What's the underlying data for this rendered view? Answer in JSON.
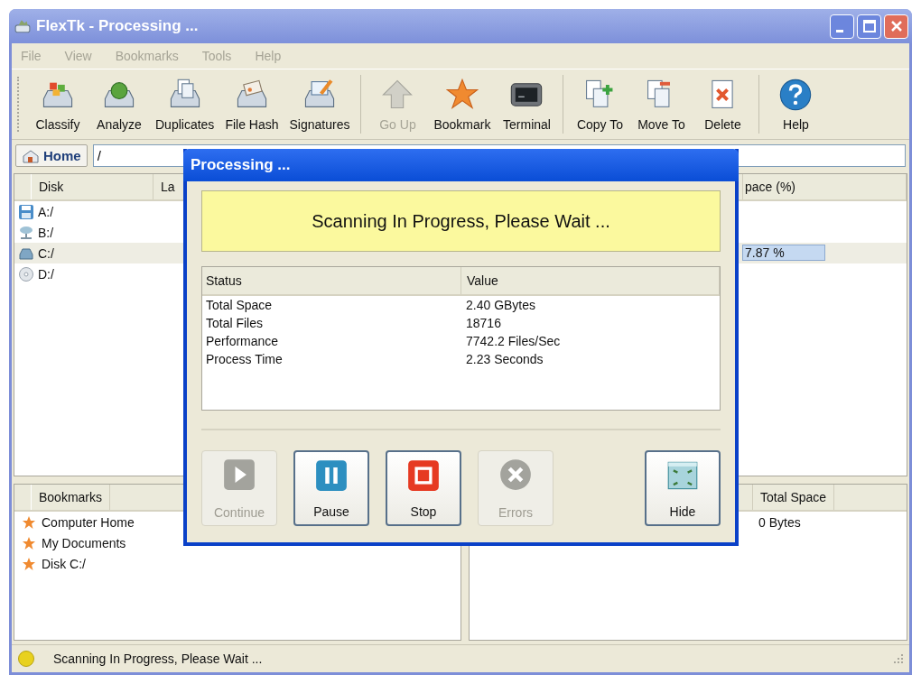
{
  "window": {
    "title": "FlexTk - Processing ..."
  },
  "menu": [
    {
      "label": "File",
      "disabled": true
    },
    {
      "label": "View",
      "disabled": true
    },
    {
      "label": "Bookmarks",
      "disabled": true
    },
    {
      "label": "Tools",
      "disabled": true
    },
    {
      "label": "Help",
      "disabled": true
    }
  ],
  "toolbar": [
    {
      "label": "Classify",
      "kind": "classify",
      "disabled": false,
      "separator_before": false
    },
    {
      "label": "Analyze",
      "kind": "analyze",
      "disabled": false,
      "separator_before": false
    },
    {
      "label": "Duplicates",
      "kind": "duplicates",
      "disabled": false,
      "separator_before": false
    },
    {
      "label": "File Hash",
      "kind": "hash",
      "disabled": false,
      "separator_before": false
    },
    {
      "label": "Signatures",
      "kind": "signatures",
      "disabled": false,
      "separator_before": false
    },
    {
      "label": "Go Up",
      "kind": "up",
      "disabled": true,
      "separator_before": true
    },
    {
      "label": "Bookmark",
      "kind": "star",
      "disabled": false,
      "separator_before": false
    },
    {
      "label": "Terminal",
      "kind": "terminal",
      "disabled": false,
      "separator_before": false
    },
    {
      "label": "Copy To",
      "kind": "copy",
      "disabled": false,
      "separator_before": true
    },
    {
      "label": "Move To",
      "kind": "move",
      "disabled": false,
      "separator_before": false
    },
    {
      "label": "Delete",
      "kind": "delete",
      "disabled": false,
      "separator_before": false
    },
    {
      "label": "Help",
      "kind": "help",
      "disabled": false,
      "separator_before": true
    }
  ],
  "address": {
    "home": "Home",
    "path": "/"
  },
  "disks": {
    "columns": [
      "Disk",
      "La",
      "pace (%)"
    ],
    "rows": [
      {
        "name": "A:/",
        "kind": "floppy",
        "selected": false
      },
      {
        "name": "B:/",
        "kind": "network",
        "selected": false
      },
      {
        "name": "C:/",
        "kind": "drive",
        "selected": true,
        "space": "7.87 %"
      },
      {
        "name": "D:/",
        "kind": "cdrom",
        "selected": false
      }
    ]
  },
  "bookmarks": {
    "column": "Bookmarks",
    "items": [
      "Computer Home",
      "My Documents",
      "Disk C:/"
    ]
  },
  "details": {
    "column": "Total Space",
    "rows": [
      "0 Bytes"
    ]
  },
  "status_bar": {
    "text": "Scanning In Progress, Please Wait ..."
  },
  "dialog": {
    "title": "Processing ...",
    "banner": "Scanning In Progress, Please Wait ...",
    "columns": [
      "Status",
      "Value"
    ],
    "rows": [
      [
        "Total Space",
        "2.40 GBytes"
      ],
      [
        "Total Files",
        "18716"
      ],
      [
        "Performance",
        "7742.2 Files/Sec"
      ],
      [
        "Process Time",
        "2.23 Seconds"
      ]
    ],
    "buttons": [
      {
        "label": "Continue",
        "kind": "play",
        "disabled": true
      },
      {
        "label": "Pause",
        "kind": "pause",
        "disabled": false
      },
      {
        "label": "Stop",
        "kind": "stop",
        "disabled": false
      },
      {
        "label": "Errors",
        "kind": "error",
        "disabled": true
      },
      {
        "label": "Hide",
        "kind": "hide",
        "disabled": false
      }
    ]
  }
}
